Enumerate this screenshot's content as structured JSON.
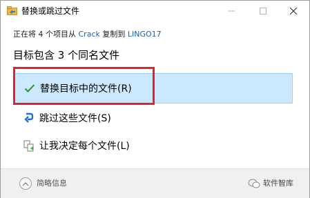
{
  "window": {
    "title": "替换或跳过文件",
    "icons": {
      "app": "copy-files-icon",
      "minimize": "minimize-icon",
      "maximize": "maximize-icon",
      "close": "close-icon"
    }
  },
  "copy_info": {
    "prefix": "正在将 4 个项目从 ",
    "source": "Crack",
    "middle": " 复制到 ",
    "destination": "LINGO17"
  },
  "heading": "目标包含 3 个同名文件",
  "options": [
    {
      "label": "替换目标中的文件(R)",
      "icon": "checkmark-icon",
      "selected": true
    },
    {
      "label": "跳过这些文件(S)",
      "icon": "skip-arrow-icon"
    },
    {
      "label": "让我决定每个文件(L)",
      "icon": "compare-files-icon"
    }
  ],
  "footer": {
    "details_label": "简略信息",
    "watermark": "软件智库"
  },
  "colors": {
    "selected_bg": "#cce8ff",
    "selected_border": "#99d1ff",
    "check_green": "#2e9e3e",
    "highlight_red": "#e8202a",
    "link_blue": "#1a5fb4"
  }
}
